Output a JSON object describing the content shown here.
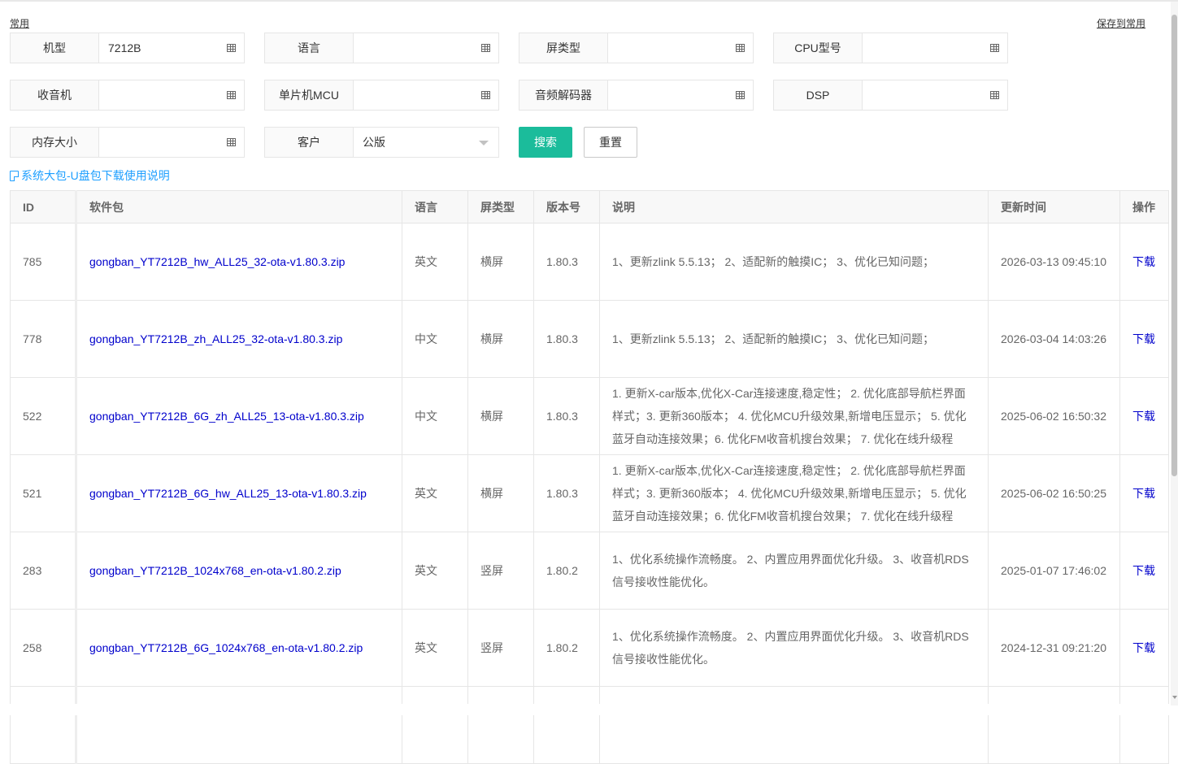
{
  "header": {
    "frequent_label": "常用",
    "save_label": "保存到常用"
  },
  "filters": {
    "model": {
      "label": "机型",
      "value": "7212B"
    },
    "language": {
      "label": "语言",
      "value": ""
    },
    "screen_type": {
      "label": "屏类型",
      "value": ""
    },
    "cpu": {
      "label": "CPU型号",
      "value": ""
    },
    "radio": {
      "label": "收音机",
      "value": ""
    },
    "mcu": {
      "label": "单片机MCU",
      "value": ""
    },
    "audio_decoder": {
      "label": "音频解码器",
      "value": ""
    },
    "dsp": {
      "label": "DSP",
      "value": ""
    },
    "memory": {
      "label": "内存大小",
      "value": ""
    },
    "customer": {
      "label": "客户",
      "value": "公版"
    }
  },
  "buttons": {
    "search": "搜索",
    "reset": "重置"
  },
  "guide_link": "系统大包-U盘包下载使用说明",
  "table": {
    "columns": [
      "ID",
      "软件包",
      "语言",
      "屏类型",
      "版本号",
      "说明",
      "更新时间",
      "操作"
    ],
    "rows": [
      {
        "id": "785",
        "package": "gongban_YT7212B_hw_ALL25_32-ota-v1.80.3.zip",
        "language": "英文",
        "screen": "横屏",
        "version": "1.80.3",
        "desc": "1、更新zlink 5.5.13； 2、适配新的触摸IC； 3、优化已知问题；",
        "updated": "2026-03-13 09:45:10",
        "action": "下载"
      },
      {
        "id": "778",
        "package": "gongban_YT7212B_zh_ALL25_32-ota-v1.80.3.zip",
        "language": "中文",
        "screen": "横屏",
        "version": "1.80.3",
        "desc": "1、更新zlink 5.5.13； 2、适配新的触摸IC； 3、优化已知问题；",
        "updated": "2026-03-04 14:03:26",
        "action": "下载"
      },
      {
        "id": "522",
        "package": "gongban_YT7212B_6G_zh_ALL25_13-ota-v1.80.3.zip",
        "language": "中文",
        "screen": "横屏",
        "version": "1.80.3",
        "desc": "1. 更新X-car版本,优化X-Car连接速度,稳定性； 2. 优化底部导航栏界面样式；3. 更新360版本； 4. 优化MCU升级效果,新增电压显示； 5. 优化蓝牙自动连接效果；6. 优化FM收音机搜台效果； 7. 优化在线升级程",
        "updated": "2025-06-02 16:50:32",
        "action": "下载"
      },
      {
        "id": "521",
        "package": "gongban_YT7212B_6G_hw_ALL25_13-ota-v1.80.3.zip",
        "language": "英文",
        "screen": "横屏",
        "version": "1.80.3",
        "desc": "1. 更新X-car版本,优化X-Car连接速度,稳定性； 2. 优化底部导航栏界面样式；3. 更新360版本； 4. 优化MCU升级效果,新增电压显示； 5. 优化蓝牙自动连接效果；6. 优化FM收音机搜台效果； 7. 优化在线升级程",
        "updated": "2025-06-02 16:50:25",
        "action": "下载"
      },
      {
        "id": "283",
        "package": "gongban_YT7212B_1024x768_en-ota-v1.80.2.zip",
        "language": "英文",
        "screen": "竖屏",
        "version": "1.80.2",
        "desc": "1、优化系统操作流畅度。 2、内置应用界面优化升级。 3、收音机RDS信号接收性能优化。",
        "updated": "2025-01-07 17:46:02",
        "action": "下载"
      },
      {
        "id": "258",
        "package": "gongban_YT7212B_6G_1024x768_en-ota-v1.80.2.zip",
        "language": "英文",
        "screen": "竖屏",
        "version": "1.80.2",
        "desc": "1、优化系统操作流畅度。 2、内置应用界面优化升级。 3、收音机RDS信号接收性能优化。",
        "updated": "2024-12-31 09:21:20",
        "action": "下载"
      },
      {
        "id": "",
        "package": "",
        "language": "",
        "screen": "",
        "version": "",
        "desc": "",
        "updated": "",
        "action": ""
      }
    ]
  },
  "colors": {
    "primary": "#1bbc9b",
    "link": "#0000cc",
    "guide_link": "#1e9fff"
  }
}
